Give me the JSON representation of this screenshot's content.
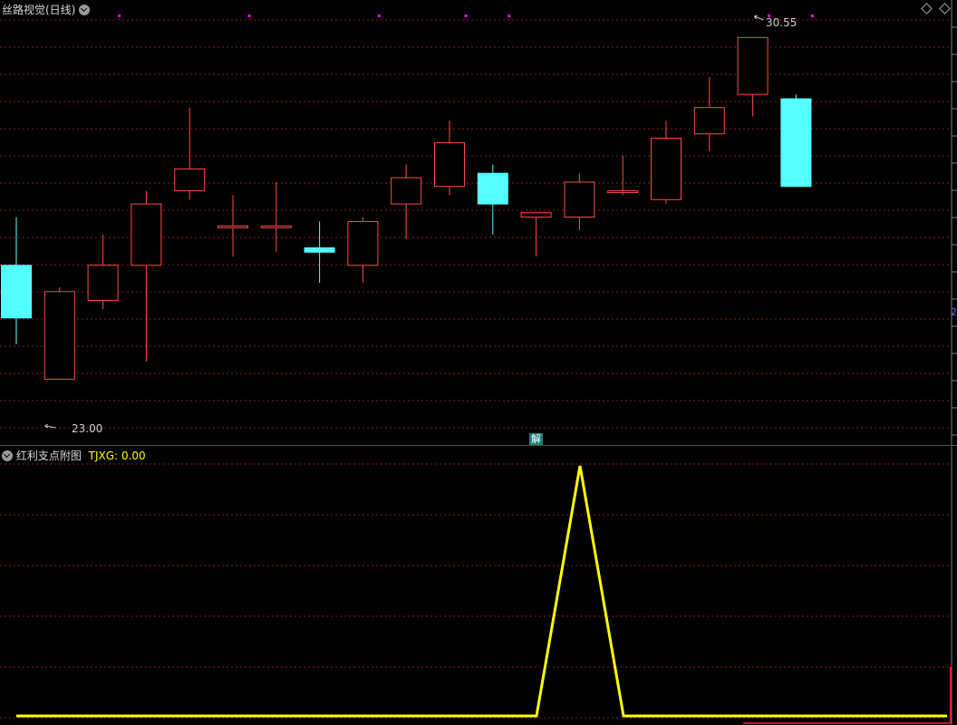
{
  "main_panel": {
    "title": "丝路视觉(日线)",
    "high_label": "30.55",
    "low_label": "23.00",
    "event_tag": "解",
    "right_edge_label": "2"
  },
  "sub_panel": {
    "title": "红利支点附图",
    "indicator_name": "TJXG:",
    "indicator_value": "0.00"
  },
  "colors": {
    "up": "#ff4a4a",
    "down": "#54ffff",
    "grid": "#8b1a1a",
    "indicator": "#ffff00",
    "marker": "#ff00ff"
  },
  "chart_data": [
    {
      "type": "candlestick",
      "ylim": [
        22.1,
        31.2
      ],
      "candles": [
        {
          "open": 25.6,
          "close": 24.4,
          "high": 26.7,
          "low": 23.8
        },
        {
          "open": 23.0,
          "close": 25.0,
          "high": 25.1,
          "low": 23.0
        },
        {
          "open": 24.8,
          "close": 25.6,
          "high": 26.3,
          "low": 24.6
        },
        {
          "open": 25.6,
          "close": 27.0,
          "high": 27.3,
          "low": 23.4
        },
        {
          "open": 27.3,
          "close": 27.8,
          "high": 29.2,
          "low": 27.1
        },
        {
          "open": 26.5,
          "close": 26.5,
          "high": 27.2,
          "low": 25.8
        },
        {
          "open": 26.5,
          "close": 26.5,
          "high": 27.5,
          "low": 25.9
        },
        {
          "open": 26.0,
          "close": 25.9,
          "high": 26.6,
          "low": 25.2
        },
        {
          "open": 25.6,
          "close": 26.6,
          "high": 26.7,
          "low": 25.2
        },
        {
          "open": 27.0,
          "close": 27.6,
          "high": 27.9,
          "low": 26.2
        },
        {
          "open": 27.4,
          "close": 28.4,
          "high": 28.9,
          "low": 27.2
        },
        {
          "open": 27.7,
          "close": 27.0,
          "high": 27.9,
          "low": 26.3
        },
        {
          "open": 26.7,
          "close": 26.8,
          "high": 26.8,
          "low": 25.8
        },
        {
          "open": 26.7,
          "close": 27.5,
          "high": 27.7,
          "low": 26.4
        },
        {
          "open": 27.3,
          "close": 27.3,
          "high": 28.1,
          "low": 27.2
        },
        {
          "open": 27.1,
          "close": 28.5,
          "high": 28.9,
          "low": 27.0
        },
        {
          "open": 28.6,
          "close": 29.2,
          "high": 29.9,
          "low": 28.2
        },
        {
          "open": 29.5,
          "close": 30.8,
          "high": 30.5,
          "low": 29.0
        },
        {
          "open": 29.4,
          "close": 27.4,
          "high": 29.5,
          "low": 27.4
        }
      ],
      "markers_top": [
        2,
        5,
        8,
        10,
        11,
        17,
        18
      ],
      "high_point": {
        "index": 17,
        "value": 30.55
      },
      "low_point": {
        "index": 1,
        "value": 23.0
      }
    },
    {
      "type": "line",
      "series": [
        {
          "name": "TJXG",
          "values": [
            0,
            0,
            0,
            0,
            0,
            0,
            0,
            0,
            0,
            0,
            0,
            0,
            0,
            1,
            0,
            0,
            0,
            0,
            0,
            0,
            0,
            0
          ]
        }
      ],
      "ylim": [
        0,
        1
      ]
    }
  ]
}
